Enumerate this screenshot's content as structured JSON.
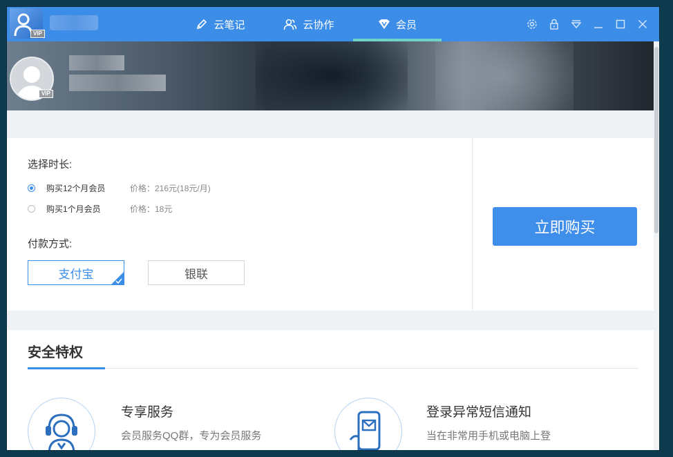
{
  "header": {
    "avatar_vip": "VIP",
    "tabs": [
      {
        "label": "云笔记",
        "icon": "pencil-icon",
        "active": false
      },
      {
        "label": "云协作",
        "icon": "people-icon",
        "active": false
      },
      {
        "label": "会员",
        "icon": "vip-diamond-icon",
        "active": true
      }
    ],
    "controls": [
      "settings-icon",
      "lock-icon",
      "dropdown-icon",
      "minimize-icon",
      "maximize-icon",
      "close-icon"
    ]
  },
  "profile": {
    "vip_badge": "VIP"
  },
  "purchase": {
    "duration_label": "选择时长:",
    "options": [
      {
        "label": "购买12个月会员",
        "price": "价格：216元(18元/月)",
        "checked": true
      },
      {
        "label": "购买1个月会员",
        "price": "价格：18元",
        "checked": false
      }
    ],
    "payment_label": "付款方式:",
    "payment_methods": [
      {
        "label": "支付宝",
        "selected": true
      },
      {
        "label": "银联",
        "selected": false
      }
    ],
    "buy_button": "立即购买"
  },
  "privileges": {
    "title": "安全特权",
    "features": [
      {
        "title": "专享服务",
        "desc": "会员服务QQ群，专为会员服务",
        "icon": "headset-support-icon"
      },
      {
        "title": "登录异常短信通知",
        "desc": "当在非常用手机或电脑上登",
        "icon": "sms-phone-icon"
      }
    ]
  },
  "colors": {
    "accent": "#3b8de8",
    "tab_indicator": "#6fd3c8",
    "buy_button": "#3f8ee9"
  }
}
